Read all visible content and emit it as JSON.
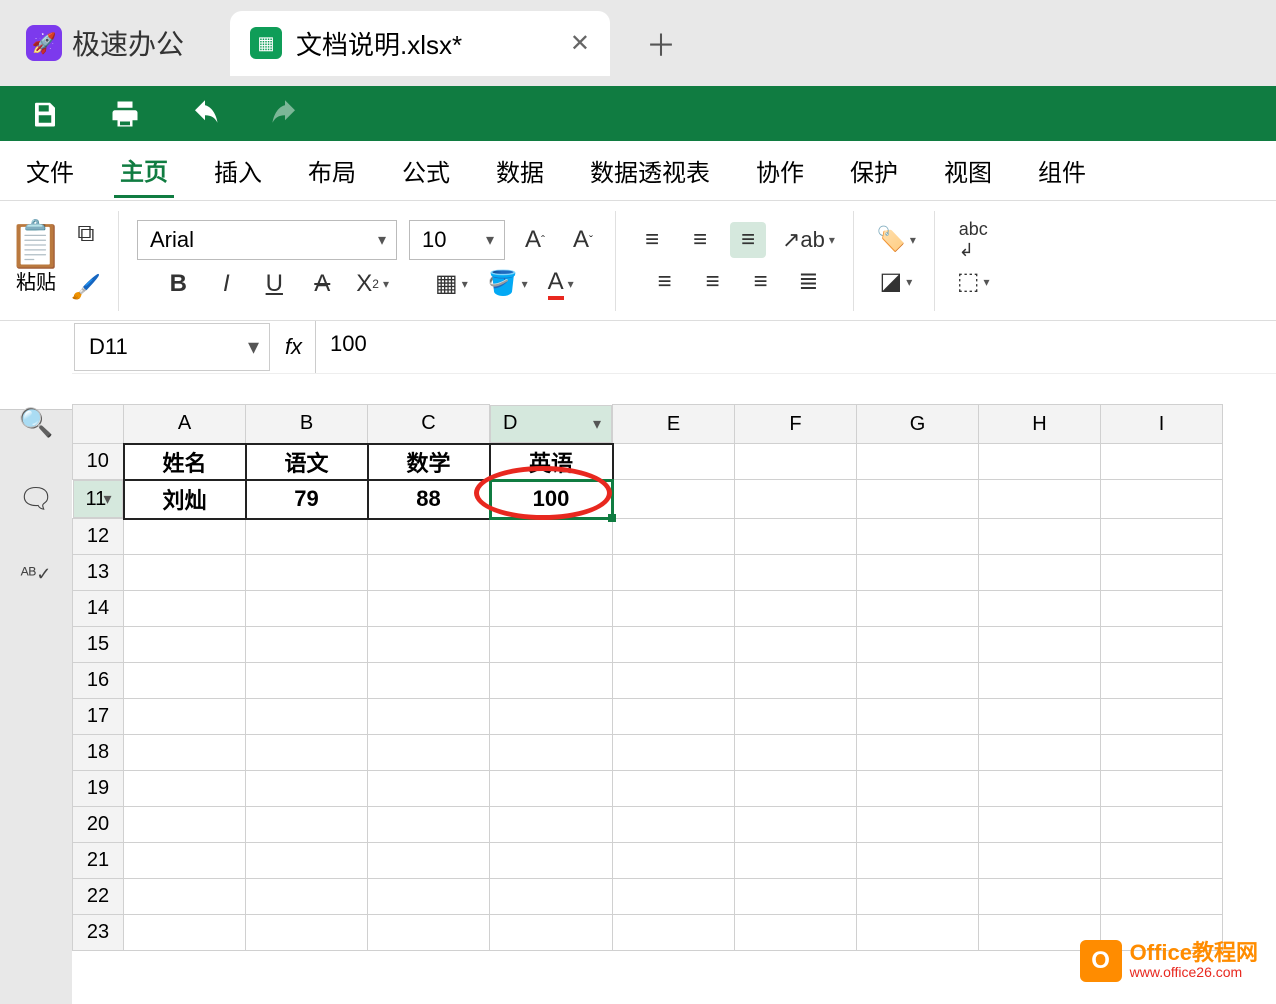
{
  "tabs": {
    "home_label": "极速办公",
    "doc_label": "文档说明.xlsx*",
    "close": "✕",
    "add": "＋"
  },
  "menu": {
    "file": "文件",
    "home": "主页",
    "insert": "插入",
    "layout": "布局",
    "formula": "公式",
    "data": "数据",
    "pivot": "数据透视表",
    "collab": "协作",
    "protect": "保护",
    "view": "视图",
    "plugin": "组件"
  },
  "ribbon": {
    "paste_label": "粘贴",
    "font_name": "Arial",
    "font_size": "10"
  },
  "cellref": {
    "name": "D11",
    "fx": "fx",
    "value": "100"
  },
  "columns": [
    "A",
    "B",
    "C",
    "D",
    "E",
    "F",
    "G",
    "H",
    "I"
  ],
  "rows": [
    "10",
    "11",
    "12",
    "13",
    "14",
    "15",
    "16",
    "17",
    "18",
    "19",
    "20",
    "21",
    "22",
    "23"
  ],
  "sheet": {
    "r10": {
      "A": "姓名",
      "B": "语文",
      "C": "数学",
      "D": "英语"
    },
    "r11": {
      "A": "刘灿",
      "B": "79",
      "C": "88",
      "D": "100"
    }
  },
  "active": {
    "col": "D",
    "row": "11"
  },
  "watermark": {
    "line1": "Office教程网",
    "line2": "www.office26.com"
  }
}
